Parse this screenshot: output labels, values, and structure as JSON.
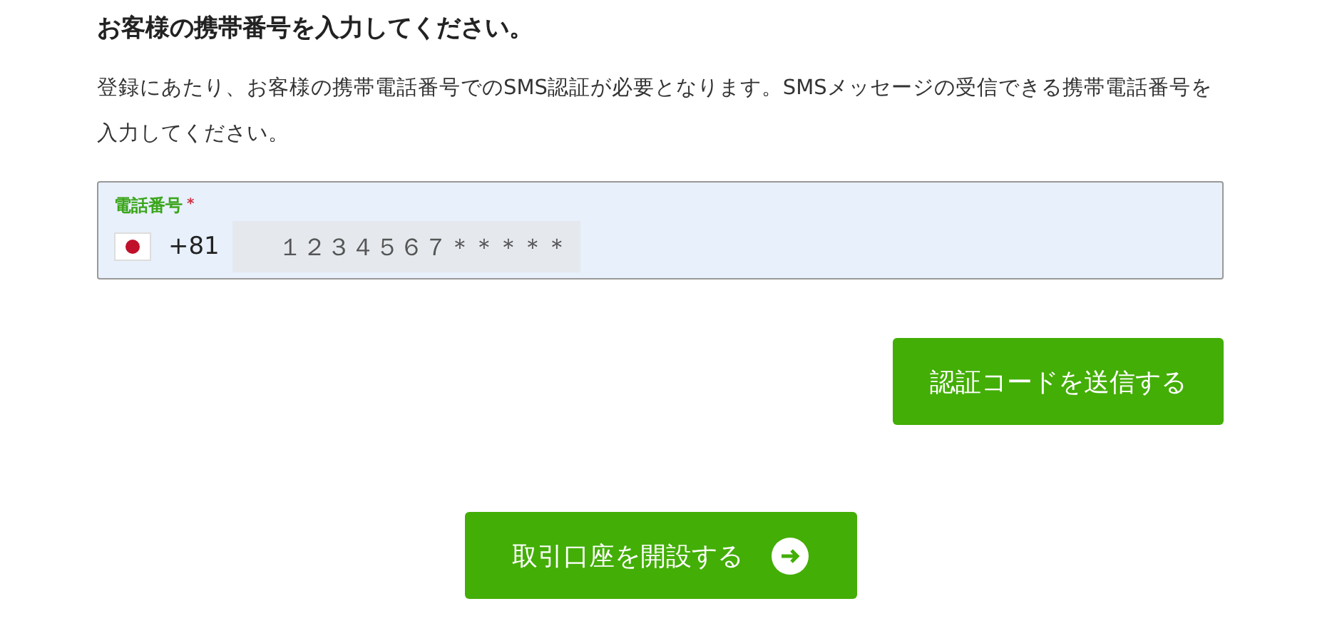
{
  "heading": "お客様の携帯番号を入力してください。",
  "description": "登録にあたり、お客様の携帯電話番号でのSMS認証が必要となります。SMSメッセージの受信できる携帯電話番号を入力してください。",
  "phone_field": {
    "label": "電話番号",
    "required_mark": "*",
    "country_code": "+81",
    "value": "１２３４５６７＊＊＊＊＊"
  },
  "send_code_button": "認証コードを送信する",
  "open_account_button": "取引口座を開設する"
}
